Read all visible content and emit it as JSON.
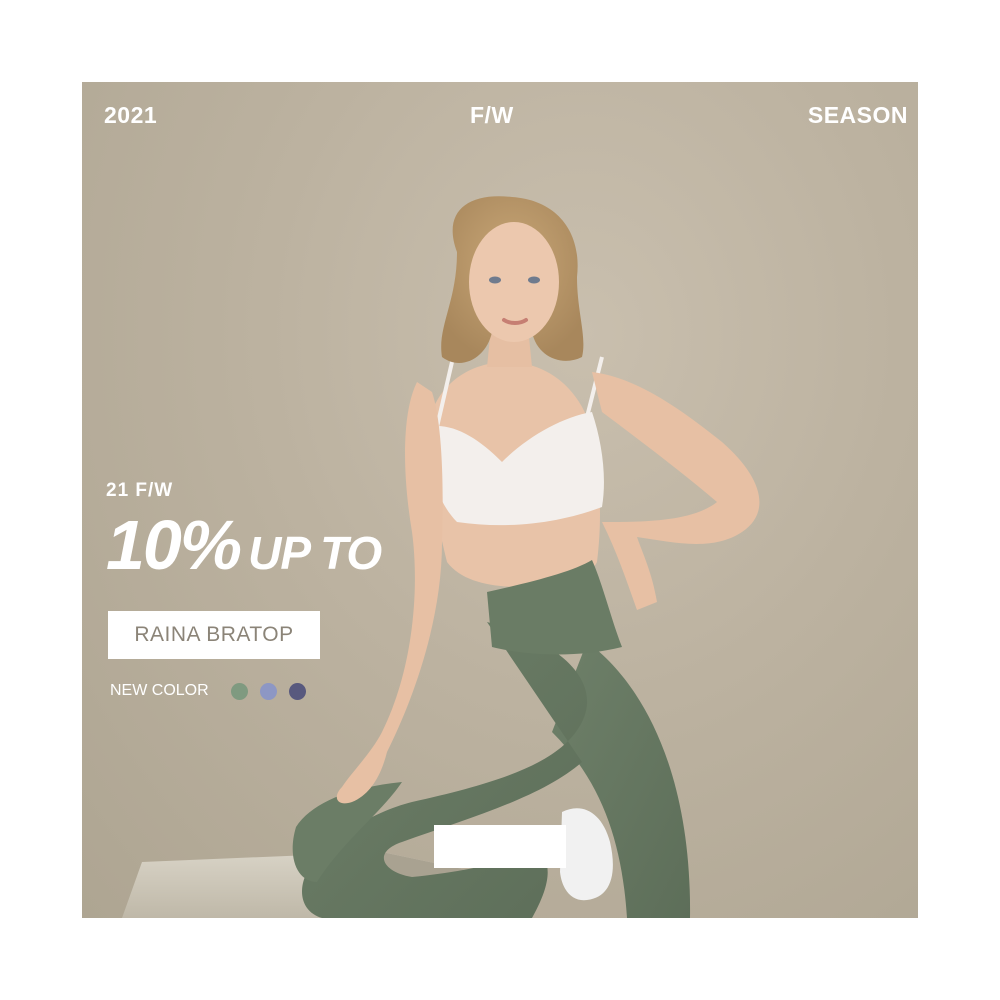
{
  "banner": {
    "top_left": "2021",
    "top_center": "F/W",
    "top_right": "SEASON",
    "season_small": "21 F/W",
    "headline_big": "10%",
    "headline_mid": "UP TO",
    "product_name": "RAINA BRATOP",
    "new_color_label": "NEW COLOR",
    "swatches": [
      {
        "name": "sage-green",
        "color": "#7f9a80"
      },
      {
        "name": "periwinkle",
        "color": "#8d97c4"
      },
      {
        "name": "navy",
        "color": "#58597e"
      }
    ],
    "background_color": "#bcb2a0"
  }
}
